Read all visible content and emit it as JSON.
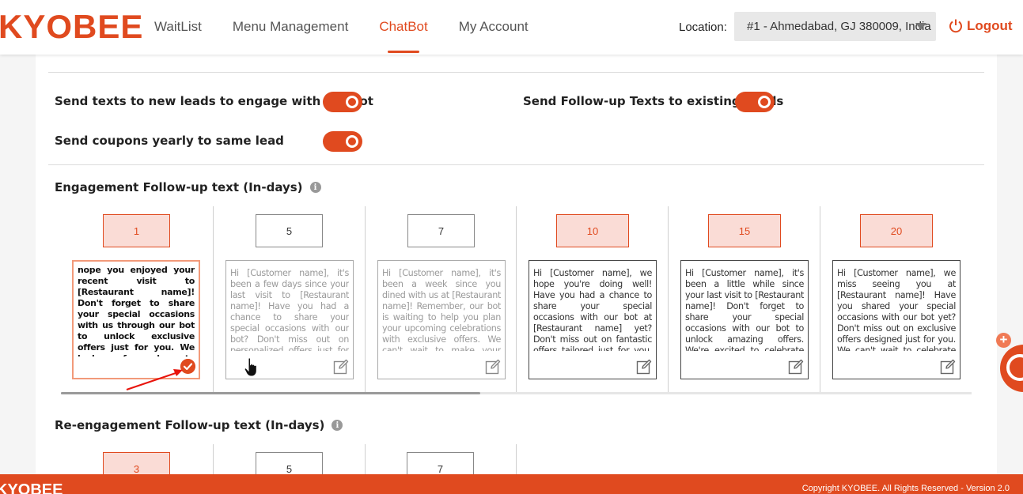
{
  "header": {
    "logo": "KYOBEE",
    "nav": [
      "WaitList",
      "Menu Management",
      "ChatBot",
      "My Account"
    ],
    "active_nav": "ChatBot",
    "location_label": "Location:",
    "location_value": "#1 - Ahmedabad, GJ 380009, India",
    "logout_label": "Logout"
  },
  "settings": {
    "toggle_new_leads": {
      "label": "Send texts to new leads to engage with the bot",
      "on": true
    },
    "toggle_followup": {
      "label": "Send Follow-up Texts to existing Leads",
      "on": true
    },
    "toggle_coupons": {
      "label": "Send coupons yearly to same lead",
      "on": true
    }
  },
  "engagement": {
    "title": "Engagement Follow-up text (In-days)",
    "columns": [
      {
        "day": "1",
        "highlighted": true,
        "editing": true,
        "text": "nope you enjoyed your recent visit to [Restaurant name]! Don't forget to share your special occasions with us through our bot to unlock exclusive offers just for you. We look forward to celebrating with you!"
      },
      {
        "day": "5",
        "highlighted": false,
        "editing": false,
        "text": "Hi [Customer name], it's been a few days since your last visit to [Restaurant name]! Have you had a chance to share your special occasions with our bot? Don't miss out on personalized offers just for you. We're here to make your celebrations memorable!"
      },
      {
        "day": "7",
        "highlighted": false,
        "editing": false,
        "text": "Hi [Customer name], it's been a week since you dined with us at [Restaurant name]! Remember, our bot is waiting to help you plan your upcoming celebrations with exclusive offers. We can't wait to make your moments special!"
      },
      {
        "day": "10",
        "highlighted": true,
        "editing": false,
        "text": "Hi [Customer name], we hope you're doing well! Have you had a chance to share your special occasions with our bot at [Restaurant name] yet? Don't miss out on fantastic offers tailored just for you. Let's make your celebrations unforgettable!"
      },
      {
        "day": "15",
        "highlighted": true,
        "editing": false,
        "text": "Hi [Customer name], it's been a little while since your last visit to [Restaurant name]! Don't forget to share your special occasions with our bot to unlock amazing offers. We're excited to celebrate with you!"
      },
      {
        "day": "20",
        "highlighted": true,
        "editing": false,
        "text": "Hi [Customer name], we miss seeing you at [Restaurant name]! Have you shared your special occasions with our bot yet? Don't miss out on exclusive offers designed just for you. We can't wait to celebrate together!"
      }
    ]
  },
  "reengagement": {
    "title": "Re-engagement Follow-up text (In-days)",
    "columns": [
      {
        "day": "3",
        "highlighted": true
      },
      {
        "day": "5",
        "highlighted": false
      },
      {
        "day": "7",
        "highlighted": false
      }
    ]
  },
  "footer": {
    "logo": "KYOBEE",
    "copyright": "Copyright KYOBEE. All Rights Reserved - Version 2.0"
  },
  "colors": {
    "accent": "#e04a1f",
    "highlight_bg": "#fadcd6"
  },
  "icons": [
    "power-icon",
    "caret-down-icon",
    "info-icon",
    "edit-icon",
    "check-icon",
    "plus-icon",
    "chat-icon",
    "hand-cursor-icon"
  ]
}
